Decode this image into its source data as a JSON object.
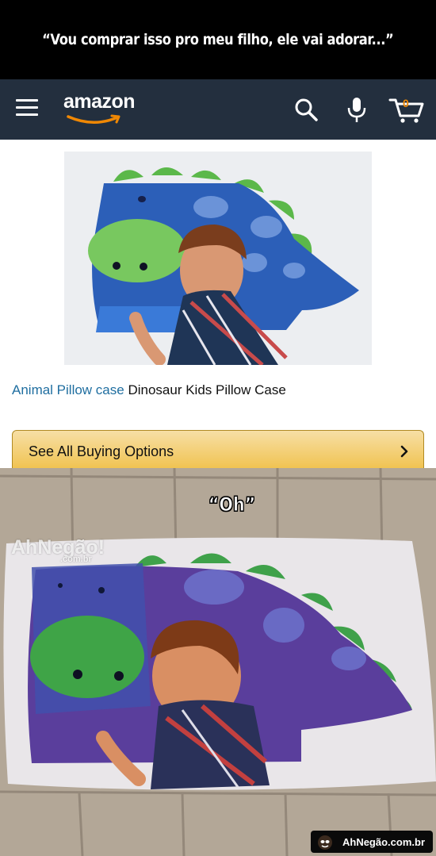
{
  "meme": {
    "caption": "“Vou comprar isso pro meu filho, ele vai adorar...”",
    "reaction": "“Oh”"
  },
  "header": {
    "logo_text": "amazon",
    "cart_count": "0",
    "icons": [
      "menu-icon",
      "search-icon",
      "microphone-icon",
      "cart-icon"
    ],
    "background_color": "#232f3e",
    "accent_color": "#f08804"
  },
  "product": {
    "title_link": "Animal Pillow case",
    "title_rest": " Dinosaur Kids Pillow Case",
    "buy_button_label": "See All Buying Options"
  },
  "watermark": {
    "brand": "AhNegão!",
    "domain": ".com.br",
    "footer": "AhNegão.com.br"
  }
}
